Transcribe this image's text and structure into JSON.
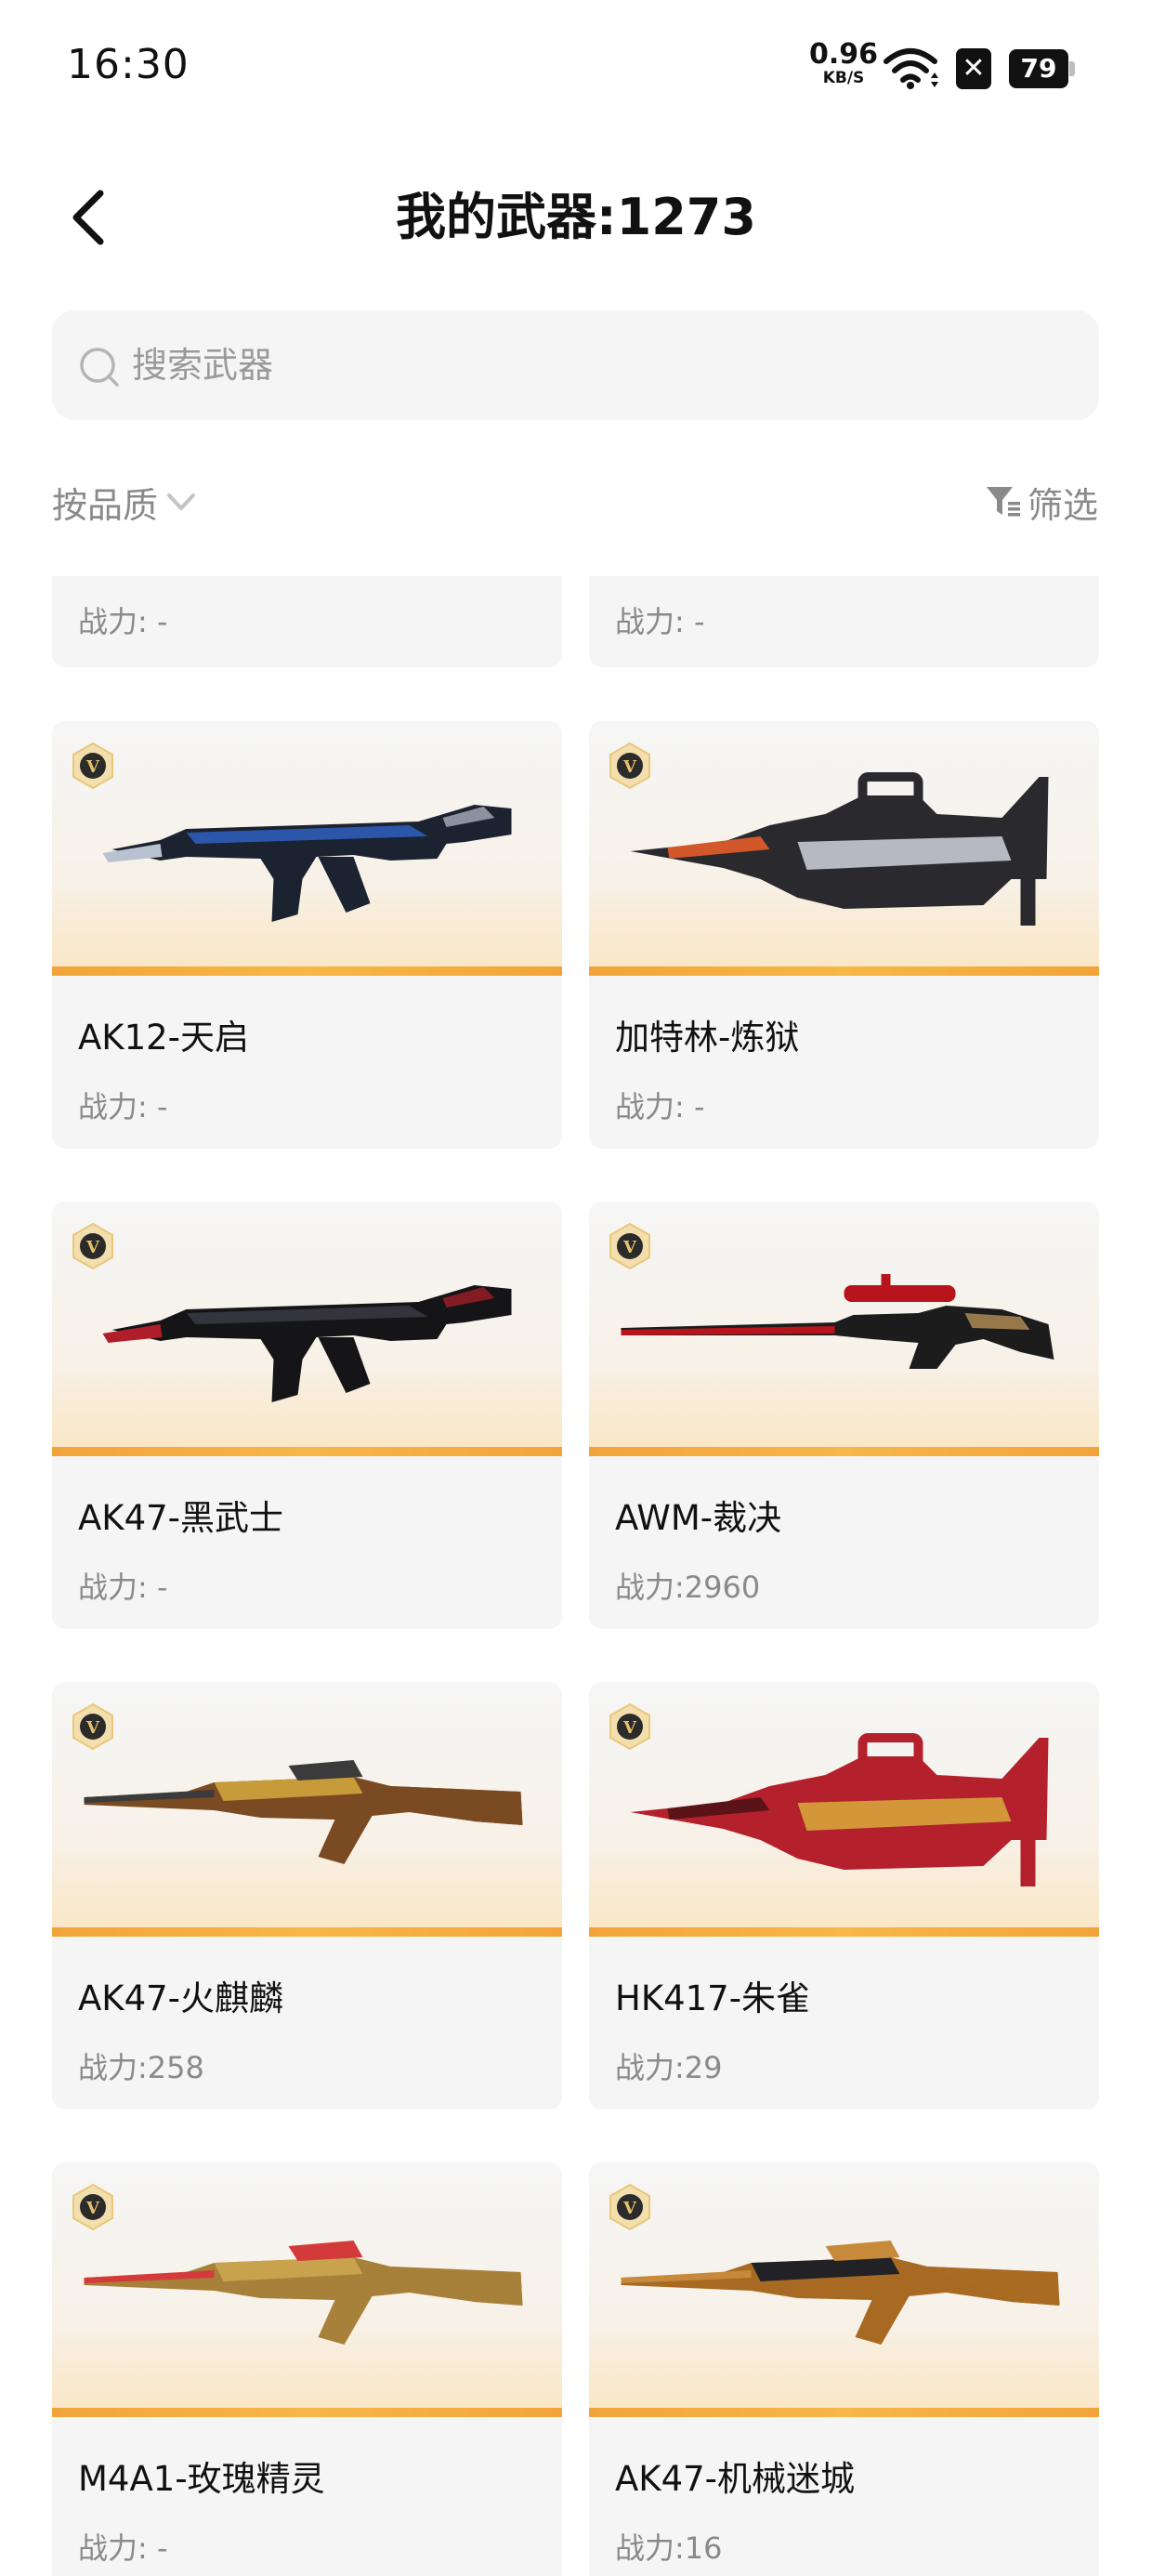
{
  "status_bar": {
    "time": "16:30",
    "net_speed_value": "0.96",
    "net_speed_unit": "KB/S",
    "notification_icon": "x-box-icon",
    "battery": "79"
  },
  "header": {
    "back_icon": "chevron-left-icon",
    "title": "我的武器:1273"
  },
  "search": {
    "placeholder": "搜索武器",
    "value": ""
  },
  "filters": {
    "sort_label": "按品质",
    "filter_label": "筛选"
  },
  "colors": {
    "quality_bar": "#f2a43a",
    "card_bg": "#f5f5f5",
    "muted_text": "#8a8a8a"
  },
  "partial_row": [
    {
      "power": "战力: -"
    },
    {
      "power": "战力: -"
    }
  ],
  "weapons": [
    {
      "name": "AK12-天启",
      "power": "战力: -",
      "badge": "V",
      "palette": [
        "#1b2230",
        "#2f5fbf",
        "#b9c2d0"
      ]
    },
    {
      "name": "加特林-炼狱",
      "power": "战力: -",
      "badge": "V",
      "palette": [
        "#2a2a2e",
        "#c5c9d1",
        "#d2572a"
      ]
    },
    {
      "name": "AK47-黑武士",
      "power": "战力: -",
      "badge": "V",
      "palette": [
        "#151518",
        "#3a3a44",
        "#b01e2a"
      ]
    },
    {
      "name": "AWM-裁决",
      "power": "战力:2960",
      "badge": "V",
      "palette": [
        "#b8141c",
        "#1c1c1c",
        "#e8b56a"
      ]
    },
    {
      "name": "AK47-火麒麟",
      "power": "战力:258",
      "badge": "V",
      "palette": [
        "#c79a3a",
        "#7a4a22",
        "#3b3b3b"
      ]
    },
    {
      "name": "HK417-朱雀",
      "power": "战力:29",
      "badge": "V",
      "palette": [
        "#b4202c",
        "#d6a33b",
        "#5a1316"
      ]
    },
    {
      "name": "M4A1-玫瑰精灵",
      "power": "战力: -",
      "badge": "V",
      "palette": [
        "#c9a24e",
        "#a7803a",
        "#d43a3a"
      ]
    },
    {
      "name": "AK47-机械迷城",
      "power": "战力:16",
      "badge": "V",
      "palette": [
        "#222226",
        "#a86a22",
        "#c78a3a"
      ]
    }
  ]
}
